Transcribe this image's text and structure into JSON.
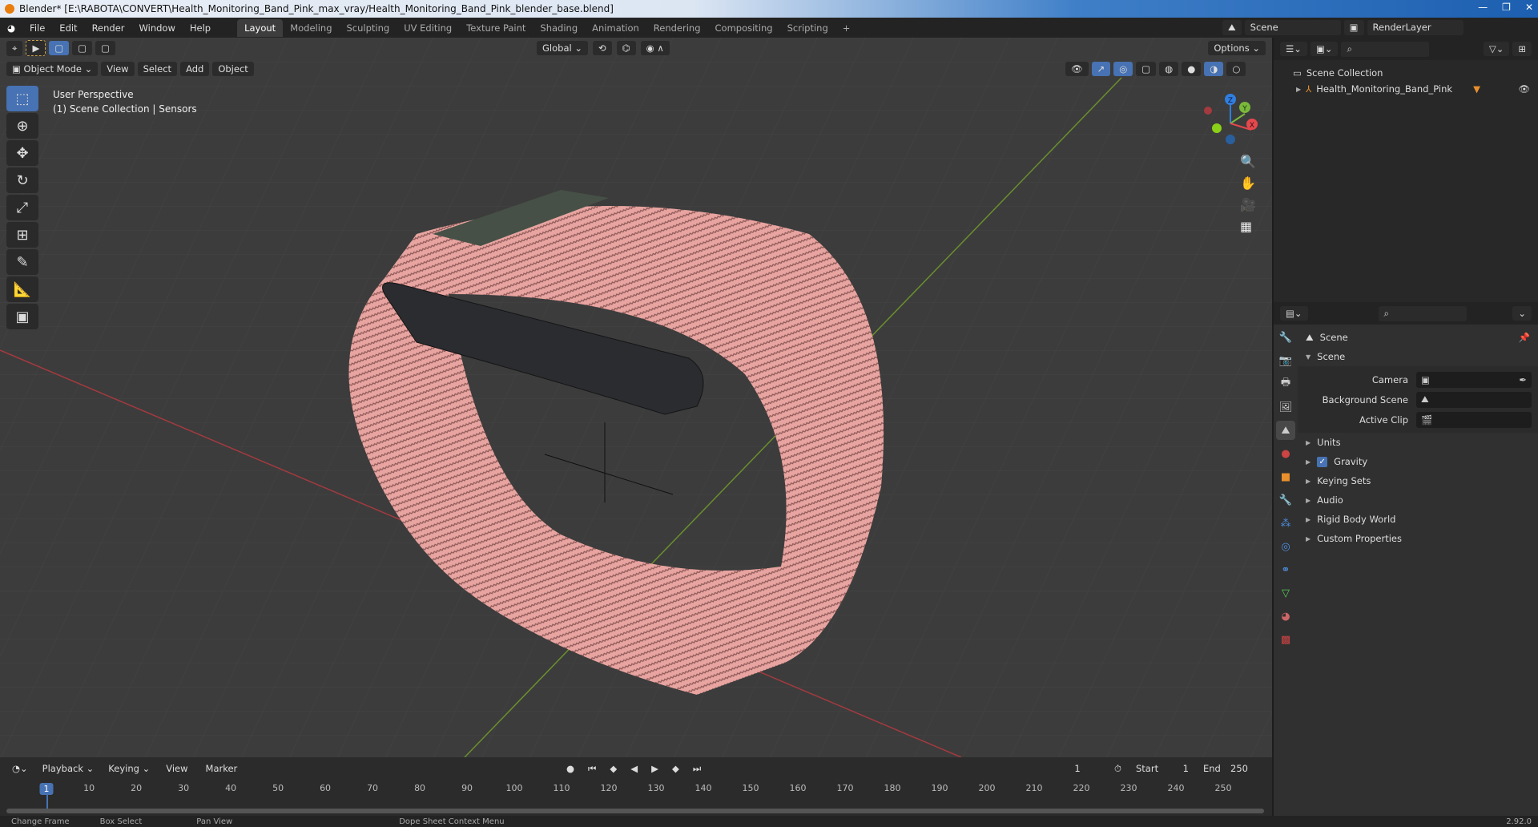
{
  "title": "Blender* [E:\\RABOTA\\CONVERT\\Health_Monitoring_Band_Pink_max_vray/Health_Monitoring_Band_Pink_blender_base.blend]",
  "menu": [
    "File",
    "Edit",
    "Render",
    "Window",
    "Help"
  ],
  "workspaces": [
    "Layout",
    "Modeling",
    "Sculpting",
    "UV Editing",
    "Texture Paint",
    "Shading",
    "Animation",
    "Rendering",
    "Compositing",
    "Scripting"
  ],
  "active_workspace": "Layout",
  "scene_name": "Scene",
  "render_layer": "RenderLayer",
  "tool_header": {
    "orientation": "Global",
    "options": "Options"
  },
  "viewport_header": {
    "mode": "Object Mode",
    "menus": [
      "View",
      "Select",
      "Add",
      "Object"
    ]
  },
  "viewport_info": {
    "line1": "User Perspective",
    "line2": "(1) Scene Collection | Sensors"
  },
  "gizmo": {
    "x": "X",
    "y": "Y",
    "z": "Z"
  },
  "colors": {
    "accent": "#4772b3",
    "band": "#e8a4a0",
    "x_axis": "#e5484d",
    "y_axis": "#7ab83a",
    "z_axis": "#2f7fe0"
  },
  "outliner": {
    "root": "Scene Collection",
    "items": [
      {
        "name": "Health_Monitoring_Band_Pink",
        "visible": true
      }
    ]
  },
  "properties": {
    "context": "Scene",
    "section": "Scene",
    "fields": [
      {
        "label": "Camera",
        "value": ""
      },
      {
        "label": "Background Scene",
        "value": ""
      },
      {
        "label": "Active Clip",
        "value": ""
      }
    ],
    "panels": [
      {
        "label": "Units"
      },
      {
        "label": "Gravity",
        "checkbox": true
      },
      {
        "label": "Keying Sets"
      },
      {
        "label": "Audio"
      },
      {
        "label": "Rigid Body World"
      },
      {
        "label": "Custom Properties"
      }
    ]
  },
  "timeline": {
    "menus": [
      "Playback",
      "Keying",
      "View",
      "Marker"
    ],
    "current_frame": "1",
    "start_label": "Start",
    "start": "1",
    "end_label": "End",
    "end": "250",
    "ticks": [
      1,
      10,
      20,
      30,
      40,
      50,
      60,
      70,
      80,
      90,
      100,
      110,
      120,
      130,
      140,
      150,
      160,
      170,
      180,
      190,
      200,
      210,
      220,
      230,
      240,
      250
    ]
  },
  "status": {
    "items": [
      "Change Frame",
      "Box Select",
      "Pan View",
      "Dope Sheet Context Menu"
    ],
    "version": "2.92.0"
  }
}
